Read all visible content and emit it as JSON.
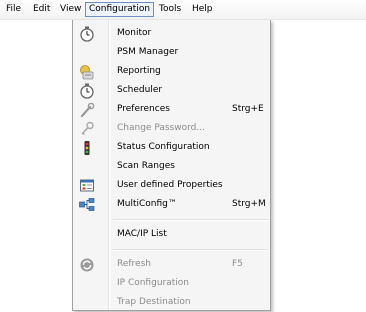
{
  "menubar": {
    "items": [
      {
        "label": "File"
      },
      {
        "label": "Edit"
      },
      {
        "label": "View"
      },
      {
        "label": "Configuration",
        "active": true
      },
      {
        "label": "Tools"
      },
      {
        "label": "Help"
      }
    ]
  },
  "configuration_menu": {
    "items": [
      {
        "label": "Monitor",
        "shortcut": "",
        "icon": "stopwatch-icon",
        "enabled": true
      },
      {
        "label": "PSM Manager",
        "shortcut": "",
        "icon": "",
        "enabled": true
      },
      {
        "label": "Reporting",
        "shortcut": "",
        "icon": "reporting-icon",
        "enabled": true
      },
      {
        "label": "Scheduler",
        "shortcut": "",
        "icon": "stopwatch-icon",
        "enabled": true
      },
      {
        "label": "Preferences",
        "shortcut": "Strg+E",
        "icon": "wrench-icon",
        "enabled": true
      },
      {
        "label": "Change Password...",
        "shortcut": "",
        "icon": "key-icon",
        "enabled": false
      },
      {
        "label": "Status Configuration",
        "shortcut": "",
        "icon": "traffic-light-icon",
        "enabled": true
      },
      {
        "label": "Scan Ranges",
        "shortcut": "",
        "icon": "",
        "enabled": true
      },
      {
        "label": "User defined Properties",
        "shortcut": "",
        "icon": "properties-icon",
        "enabled": true
      },
      {
        "label": "MultiConfig™",
        "shortcut": "Strg+M",
        "icon": "network-icon",
        "enabled": true
      },
      {
        "label": "MAC/IP List",
        "shortcut": "",
        "icon": "",
        "enabled": true
      },
      {
        "label": "Refresh",
        "shortcut": "F5",
        "icon": "refresh-icon",
        "enabled": false
      },
      {
        "label": "IP Configuration",
        "shortcut": "",
        "icon": "",
        "enabled": false
      },
      {
        "label": "Trap Destination",
        "shortcut": "",
        "icon": "",
        "enabled": false
      }
    ]
  }
}
